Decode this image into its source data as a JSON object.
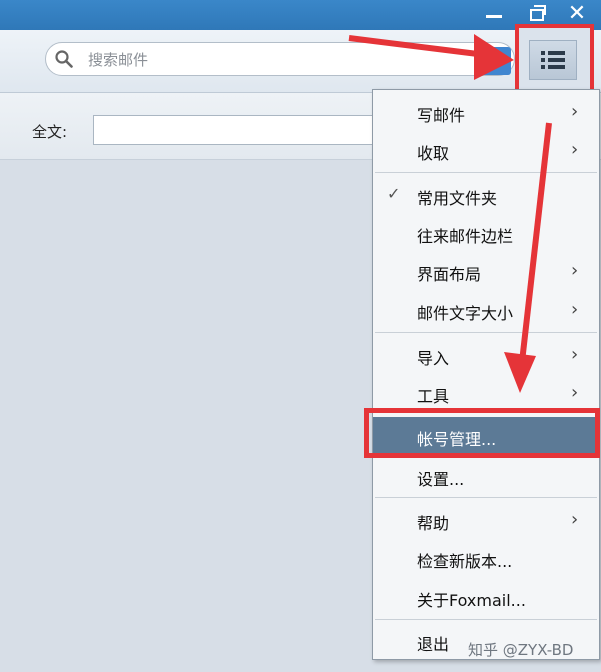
{
  "window_controls": {
    "minimize_icon": "minimize-icon",
    "restore_icon": "restore-icon",
    "close_label": "✕"
  },
  "search": {
    "placeholder": "搜索邮件",
    "value": "",
    "icon": "search-icon",
    "expand_label": "︽"
  },
  "filter": {
    "label": "全文:",
    "value": ""
  },
  "menu_button": {
    "icon": "list-menu-icon"
  },
  "menu": {
    "items": [
      {
        "label": "写邮件",
        "submenu": true
      },
      {
        "label": "收取",
        "submenu": true
      },
      {
        "label": "常用文件夹",
        "checked": true
      },
      {
        "label": "往来邮件边栏"
      },
      {
        "label": "界面布局",
        "submenu": true
      },
      {
        "label": "邮件文字大小",
        "submenu": true
      },
      {
        "label": "导入",
        "submenu": true
      },
      {
        "label": "工具",
        "submenu": true
      },
      {
        "label": "帐号管理...",
        "highlighted": true
      },
      {
        "label": "设置..."
      },
      {
        "label": "帮助",
        "submenu": true
      },
      {
        "label": "检查新版本..."
      },
      {
        "label": "关于Foxmail..."
      },
      {
        "label": "退出"
      }
    ]
  },
  "annotation_color": "#e53438",
  "watermark": "知乎 @ZYX-BD"
}
